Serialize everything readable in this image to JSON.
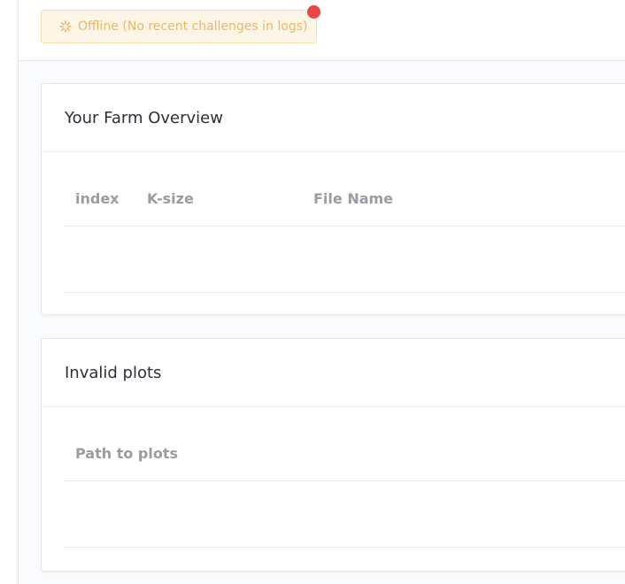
{
  "header": {
    "status_text": "Offline (No recent challenges in logs)",
    "status_color": "#e9b869",
    "status_icon": "spinner-icon",
    "notification_color": "#ea4444"
  },
  "farm_card": {
    "title": "Your Farm Overview",
    "columns": [
      "index",
      "K-size",
      "File Name"
    ],
    "rows": []
  },
  "invalid_card": {
    "title": "Invalid plots",
    "columns": [
      "Path to plots"
    ],
    "rows": []
  }
}
